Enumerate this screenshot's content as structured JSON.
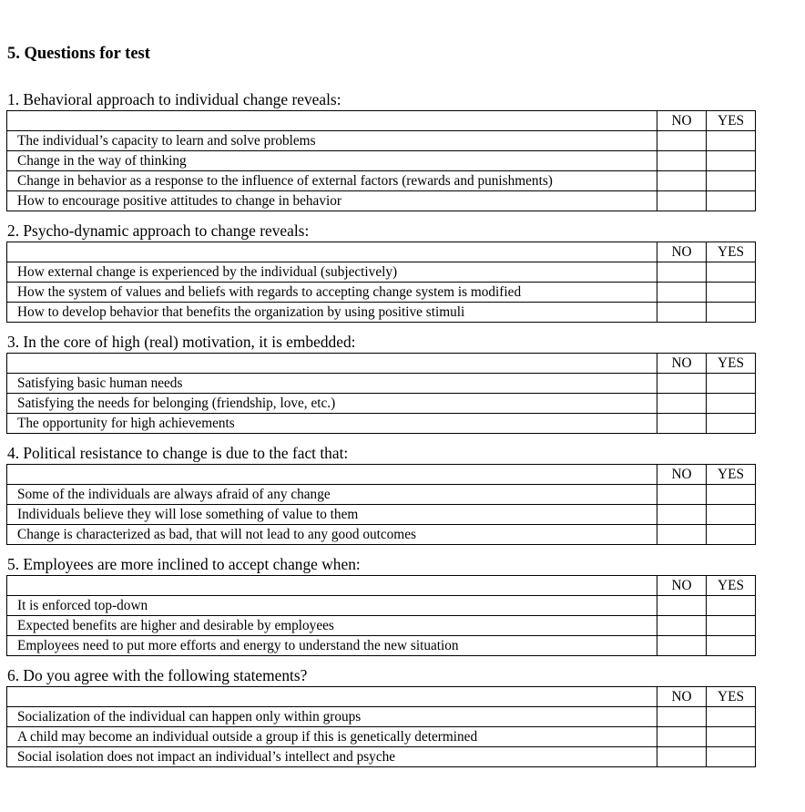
{
  "document": {
    "title": "5. Questions for test",
    "column_headers": {
      "statement": "",
      "no": "NO",
      "yes": "YES"
    }
  },
  "questions": [
    {
      "heading": "1. Behavioral approach to individual change reveals:",
      "statements": [
        "The individual’s capacity to learn and solve problems",
        "Change in the way of thinking",
        "Change in behavior as a response to the influence of external factors (rewards and punishments)",
        "How to encourage positive attitudes to change in behavior"
      ]
    },
    {
      "heading": "2. Psycho-dynamic approach to change reveals:",
      "statements": [
        "How external change is experienced by the individual (subjectively)",
        "How the system of values and beliefs with regards to accepting change system is modified",
        "How to develop behavior that benefits the organization by using positive stimuli"
      ]
    },
    {
      "heading": "3. In the core of high (real) motivation, it is embedded:",
      "statements": [
        "Satisfying basic human needs",
        "Satisfying the needs for belonging (friendship, love, etc.)",
        "The opportunity for high achievements"
      ]
    },
    {
      "heading": "4. Political resistance to change is due to the fact that:",
      "statements": [
        "Some of the individuals are always afraid of any change",
        "Individuals believe they will lose something of value to them",
        "Change is characterized as bad, that will not lead to any good outcomes"
      ]
    },
    {
      "heading": "5. Employees are more inclined to accept change when:",
      "statements": [
        "It is enforced top-down",
        "Expected benefits are higher and desirable by employees",
        "Employees need to put more efforts and energy to understand the new situation"
      ]
    },
    {
      "heading": "6. Do you agree with the following statements?",
      "statements": [
        "Socialization of the individual can happen only within groups",
        "A child may become an individual outside a group if this is genetically determined",
        "Social isolation does not impact an individual’s intellect and psyche"
      ]
    }
  ]
}
